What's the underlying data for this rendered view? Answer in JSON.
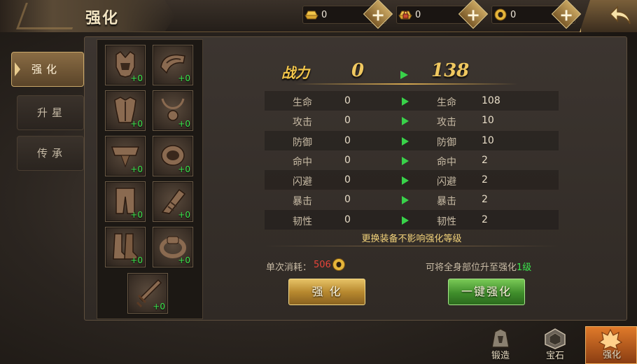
{
  "header": {
    "title": "强化",
    "currencies": [
      {
        "icon": "gold-ingot-icon",
        "value": "0"
      },
      {
        "icon": "locked-ingot-icon",
        "value": "0"
      },
      {
        "icon": "coin-icon",
        "value": "0"
      }
    ],
    "plus_label": "+"
  },
  "side_tabs": [
    {
      "label": "强化",
      "active": true
    },
    {
      "label": "升星",
      "active": false
    },
    {
      "label": "传承",
      "active": false
    }
  ],
  "equipment": [
    {
      "icon": "helmet-icon",
      "level": "+0"
    },
    {
      "icon": "shoulder-icon",
      "level": "+0"
    },
    {
      "icon": "armor-icon",
      "level": "+0"
    },
    {
      "icon": "necklace-icon",
      "level": "+0"
    },
    {
      "icon": "belt-icon",
      "level": "+0"
    },
    {
      "icon": "bracer-icon",
      "level": "+0"
    },
    {
      "icon": "pants-icon",
      "level": "+0"
    },
    {
      "icon": "gauntlet-icon",
      "level": "+0"
    },
    {
      "icon": "boots-icon",
      "level": "+0"
    },
    {
      "icon": "ring-icon",
      "level": "+0"
    },
    {
      "icon": "weapon-icon",
      "level": "+0"
    }
  ],
  "power": {
    "label": "战力",
    "current": "0",
    "next": "138"
  },
  "stats": [
    {
      "name": "生命",
      "current": "0",
      "next": "108"
    },
    {
      "name": "攻击",
      "current": "0",
      "next": "10"
    },
    {
      "name": "防御",
      "current": "0",
      "next": "10"
    },
    {
      "name": "命中",
      "current": "0",
      "next": "2"
    },
    {
      "name": "闪避",
      "current": "0",
      "next": "2"
    },
    {
      "name": "暴击",
      "current": "0",
      "next": "2"
    },
    {
      "name": "韧性",
      "current": "0",
      "next": "2"
    }
  ],
  "notice": "更换装备不影响强化等级",
  "cost": {
    "label": "单次消耗：",
    "value": "506"
  },
  "hint": {
    "prefix": "可将全身部位升至强化",
    "level": "1级"
  },
  "buttons": {
    "enhance": "强 化",
    "one_click": "一键强化"
  },
  "bottom_nav": [
    {
      "label": "锻造",
      "icon": "forge-icon",
      "active": false
    },
    {
      "label": "宝石",
      "icon": "gem-icon",
      "active": false
    },
    {
      "label": "强化",
      "icon": "enhance-icon",
      "active": true
    }
  ],
  "colors": {
    "accent_gold": "#f0c860",
    "level_green": "#3be64d",
    "cost_red": "#e8443a"
  }
}
